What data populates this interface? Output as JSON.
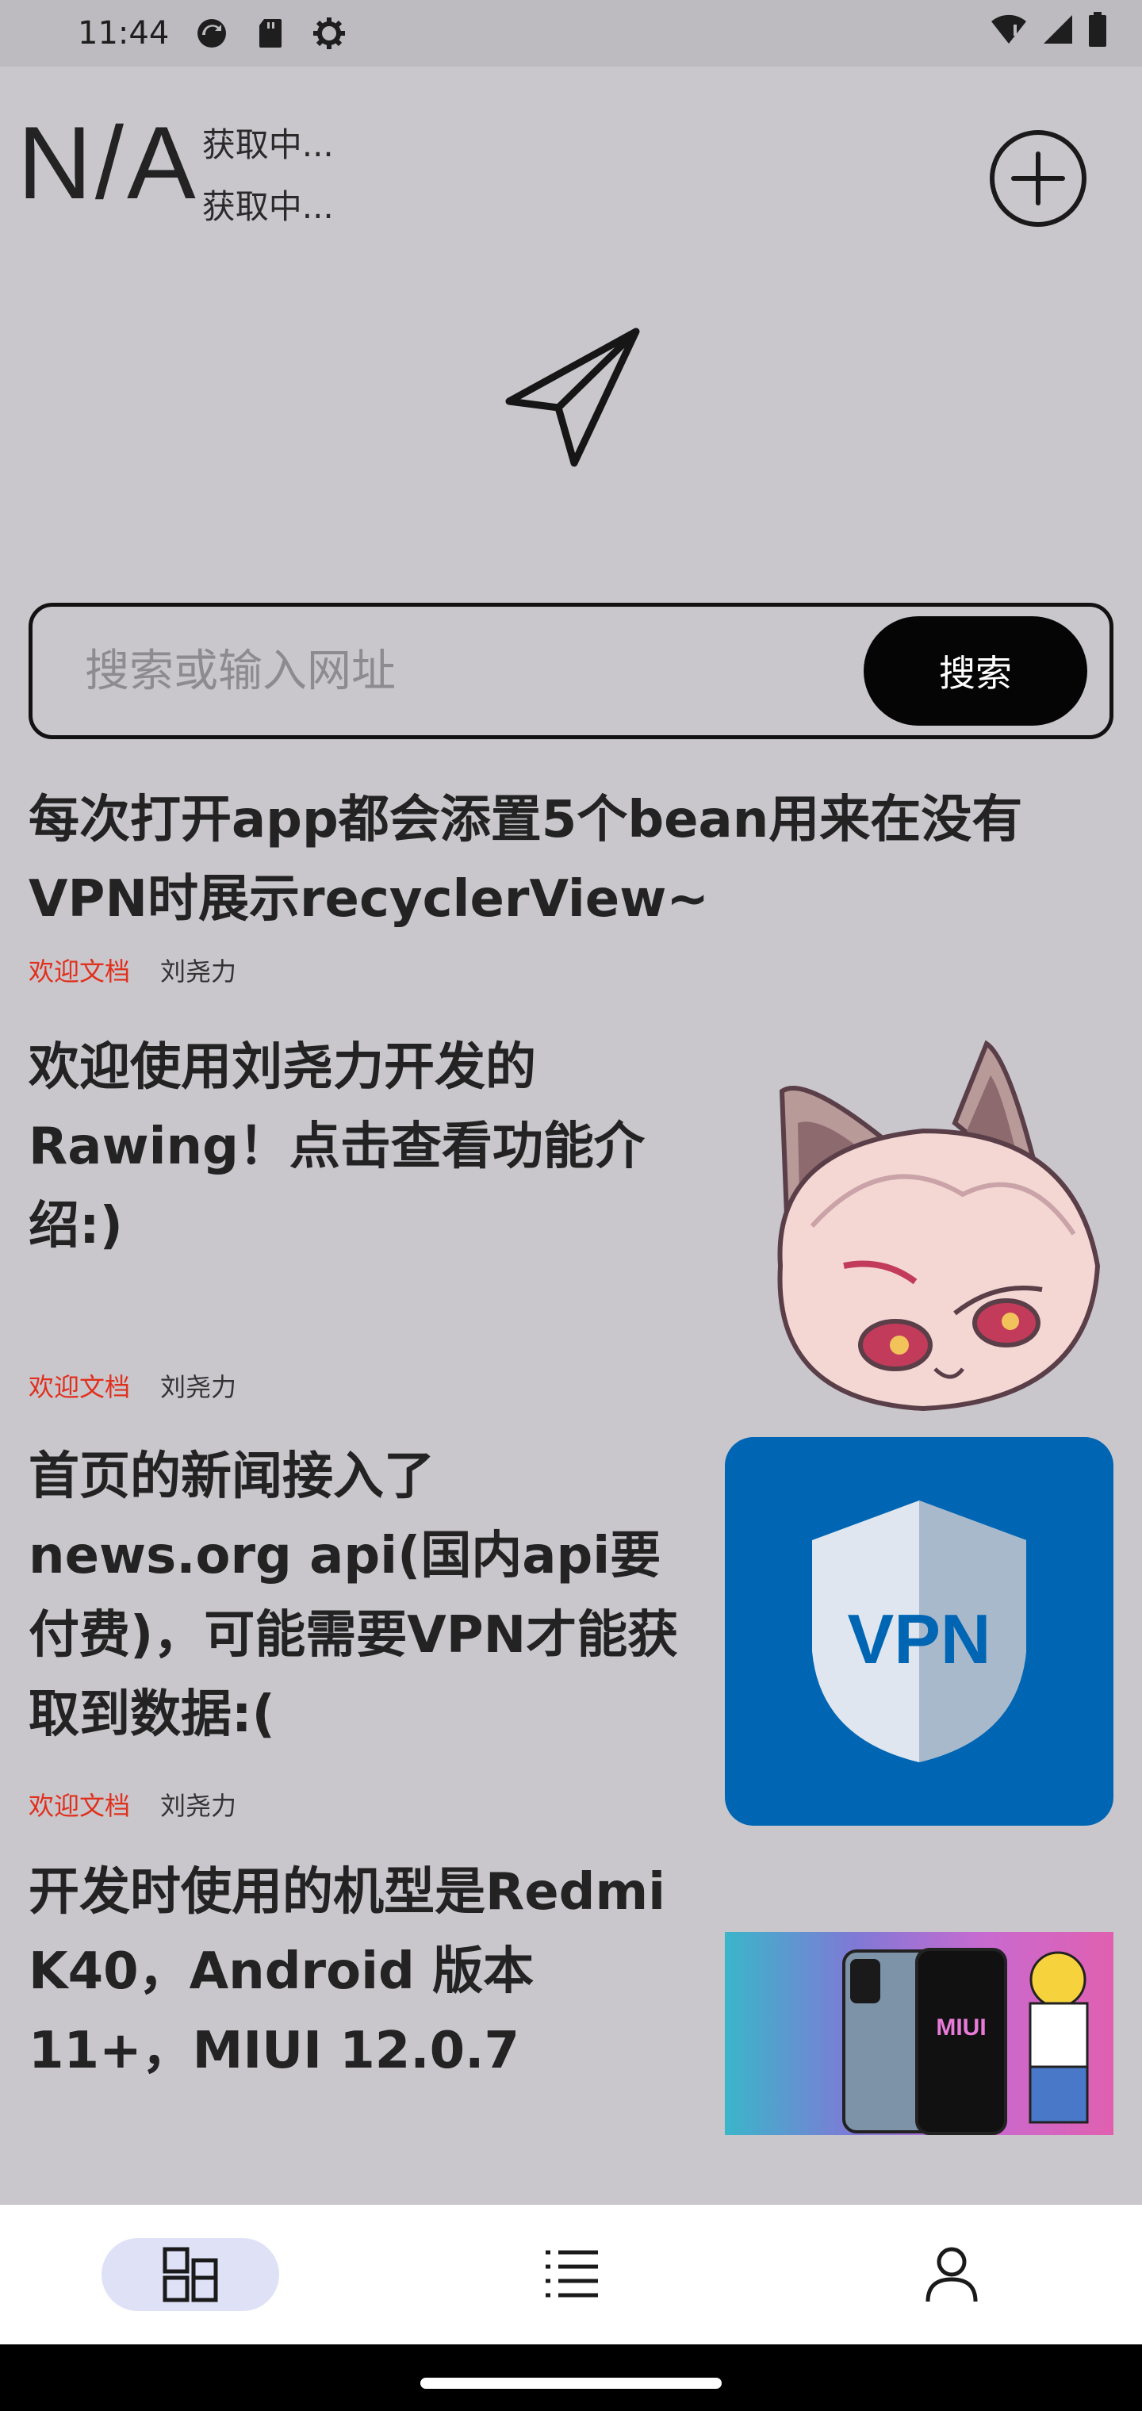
{
  "status_bar": {
    "time": "11:44"
  },
  "weather": {
    "temperature": "N/A",
    "line1": "获取中...",
    "line2": "获取中..."
  },
  "search": {
    "placeholder": "搜索或输入网址",
    "button_label": "搜索"
  },
  "news": [
    {
      "title": "每次打开app都会添置5个bean用来在没有VPN时展示recyclerView~",
      "tag": "欢迎文档",
      "author": "刘尧力"
    },
    {
      "title": "欢迎使用刘尧力开发的Rawing！点击查看功能介绍:)",
      "tag": "欢迎文档",
      "author": "刘尧力",
      "thumb_icon": "fox-girl-avatar"
    },
    {
      "title": "首页的新闻接入了news.org api(国内api要付费)，可能需要VPN才能获取到数据:(",
      "tag": "欢迎文档",
      "author": "刘尧力",
      "thumb_icon": "vpn-shield",
      "thumb_label": "VPN"
    },
    {
      "title": "开发时使用的机型是Redmi K40，Android 版本 11+，MIUI 12.0.7",
      "thumb_icon": "miui-phone",
      "thumb_label": "MIUI"
    }
  ],
  "bottom_nav": [
    {
      "icon": "dashboard-icon",
      "active": true
    },
    {
      "icon": "list-icon",
      "active": false
    },
    {
      "icon": "person-icon",
      "active": false
    }
  ],
  "colors": {
    "tag": "#e0301e",
    "nav_active_pill": "#dfe1f7",
    "vpn_blue": "#0066b3"
  }
}
